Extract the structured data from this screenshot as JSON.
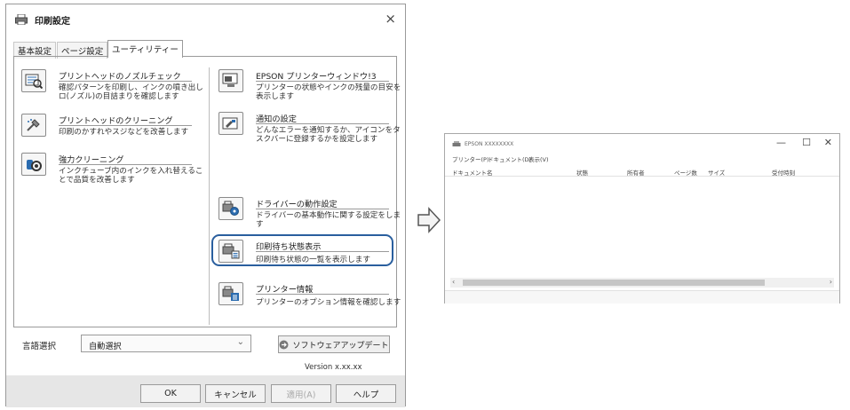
{
  "dialog": {
    "title": "印刷設定",
    "close_glyph": "×",
    "tabs": [
      {
        "label": "基本設定",
        "active": false
      },
      {
        "label": "ページ設定",
        "active": false
      },
      {
        "label": "ユーティリティー",
        "active": true
      }
    ],
    "left_items": [
      {
        "icon": "nozzle-check-icon",
        "title": "プリントヘッドのノズルチェック",
        "desc": "確認パターンを印刷し、インクの噴き出しロ(ノズル)の目詰まりを確認します"
      },
      {
        "icon": "head-cleaning-icon",
        "title": "プリントヘッドのクリーニング",
        "desc": "印刷のかすれやスジなどを改善します"
      },
      {
        "icon": "power-cleaning-icon",
        "title": "強力クリーニング",
        "desc": "インクチューブ内のインクを入れ替えることで品質を改善します"
      }
    ],
    "right_items": [
      {
        "icon": "status-monitor-icon",
        "title": "EPSON プリンターウィンドウ!3",
        "desc": "プリンターの状態やインクの残量の目安を表示します"
      },
      {
        "icon": "notification-icon",
        "title": "通知の設定",
        "desc": "どんなエラーを通知するか、アイコンをタスクバーに登録するかを設定します"
      },
      {
        "icon": "driver-settings-icon",
        "title": "ドライバーの動作設定",
        "desc": "ドライバーの基本動作に関する設定をします"
      },
      {
        "icon": "print-queue-icon",
        "title": "印刷待ち状態表示",
        "desc": "印刷待ち状態の一覧を表示します"
      },
      {
        "icon": "printer-info-icon",
        "title": "プリンター情報",
        "desc": "プリンターのオプション情報を確認します"
      }
    ],
    "language_label": "言語選択",
    "language_value": "自動選択",
    "software_update_label": "ソフトウェアアップデート",
    "version": "Version x.xx.xx",
    "buttons": {
      "ok": "OK",
      "cancel": "キャンセル",
      "apply": "適用(A)",
      "help": "ヘルプ"
    }
  },
  "queue_window": {
    "title": "EPSON XXXXXXXX",
    "controls": {
      "minimize": "—",
      "maximize": "☐",
      "close": "✕"
    },
    "menu": [
      "プリンター(P)",
      "ドキュメント(D)",
      "表示(V)"
    ],
    "columns": [
      "ドキュメント名",
      "状態",
      "所有者",
      "ページ数",
      "サイズ",
      "受付時刻"
    ]
  },
  "colors": {
    "highlight": "#2a5f9e",
    "arrow": "#555555"
  }
}
